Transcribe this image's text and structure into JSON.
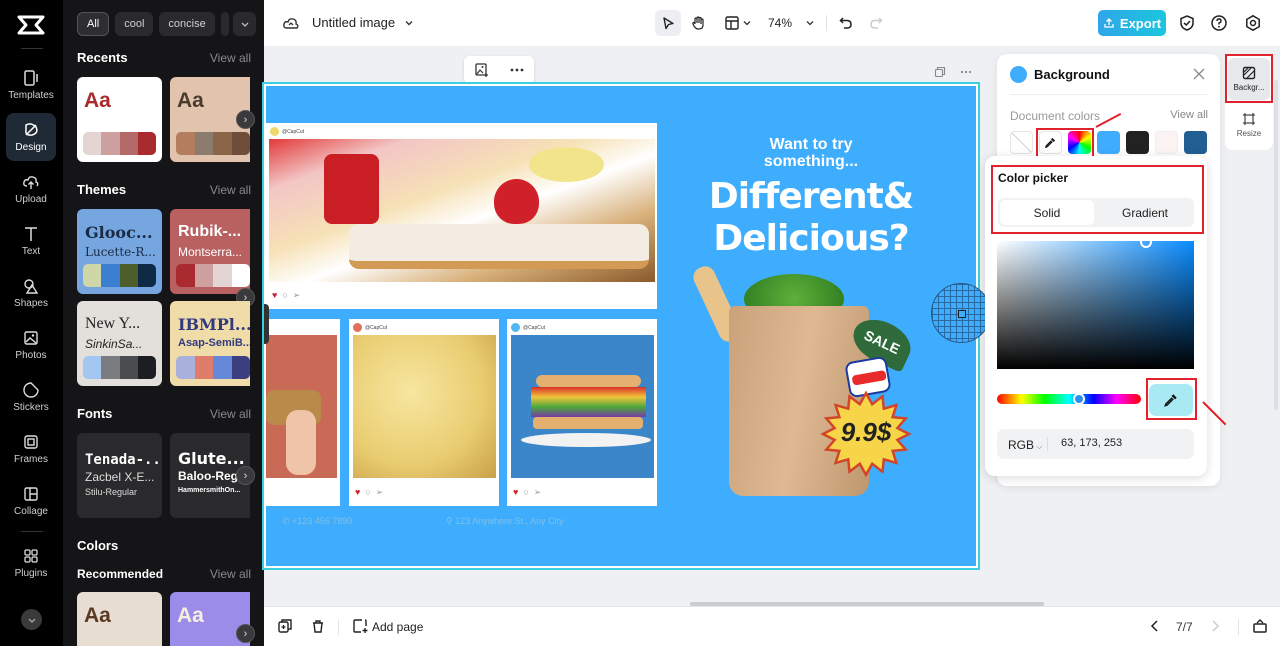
{
  "rail": {
    "items": [
      {
        "label": "Templates",
        "icon": "templates-icon"
      },
      {
        "label": "Design",
        "icon": "design-icon",
        "active": true
      },
      {
        "label": "Upload",
        "icon": "upload-icon"
      },
      {
        "label": "Text",
        "icon": "text-icon"
      },
      {
        "label": "Shapes",
        "icon": "shapes-icon"
      },
      {
        "label": "Photos",
        "icon": "photos-icon"
      },
      {
        "label": "Stickers",
        "icon": "stickers-icon"
      },
      {
        "label": "Frames",
        "icon": "frames-icon"
      },
      {
        "label": "Collage",
        "icon": "collage-icon"
      },
      {
        "label": "Plugins",
        "icon": "plugins-icon"
      }
    ]
  },
  "panel": {
    "chips": [
      "All",
      "cool",
      "concise"
    ],
    "recents": {
      "title": "Recents",
      "view_all": "View all",
      "cards": [
        {
          "aa": "Aa",
          "bg": "#ffffff",
          "fg": "#a92b2f",
          "palette": [
            "#e4d5d5",
            "#cfa0a0",
            "#b56a6a",
            "#a92b2f"
          ]
        },
        {
          "aa": "Aa",
          "bg": "#e2c3ad",
          "fg": "#4a3b2e",
          "palette": [
            "#b37d5e",
            "#8c7c6e",
            "#8c6448",
            "#6e4e39"
          ]
        }
      ]
    },
    "themes": {
      "title": "Themes",
      "view_all": "View all",
      "cards": [
        {
          "t1": "Glooc...",
          "t2": "Lucette-R...",
          "bg": "#76a6e0",
          "fg": "#1a2a44",
          "palette": [
            "#cfd6a8",
            "#3b7fd0",
            "#4e5e2a",
            "#0e2a45"
          ]
        },
        {
          "t1": "Rubik-...",
          "t2": "Montserra...",
          "bg": "#b96161",
          "fg": "#ffffff",
          "palette": [
            "#a92b2f",
            "#cfa0a0",
            "#e4d5d5",
            "#ffffff"
          ]
        },
        {
          "t1": "New Y...",
          "t2": "SinkinSa...",
          "bg": "#e3dfda",
          "fg": "#222222",
          "palette": [
            "#a3c7f0",
            "#7a7c80",
            "#4a4c50",
            "#1c1e22"
          ]
        },
        {
          "t1": "IBMPl...",
          "t2": "Asap-SemiB...",
          "bg": "#f0dca8",
          "fg": "#303a80",
          "palette": [
            "#aab0dc",
            "#e07c6a",
            "#6688d8",
            "#3b3f80"
          ]
        }
      ]
    },
    "fonts": {
      "title": "Fonts",
      "view_all": "View all",
      "cards": [
        {
          "t1": "Tenada-...",
          "t2": "Zacbel X-E...",
          "t3": "Stilu-Regular"
        },
        {
          "t1": "Glute...",
          "t2": "Baloo-Reg...",
          "t3": "HammersmithOn..."
        }
      ]
    },
    "colors": {
      "title": "Colors",
      "sub": "Recommended",
      "view_all": "View all",
      "cards": [
        {
          "aa": "Aa",
          "bg": "#e8ddd2",
          "fg": "#5a3a22"
        },
        {
          "aa": "Aa",
          "bg": "#9a8ce8",
          "fg": "#f5efe0"
        }
      ]
    }
  },
  "topbar": {
    "doc_title": "Untitled image",
    "zoom": "74%",
    "export_label": "Export"
  },
  "canvas": {
    "handle": "@CapCut",
    "headline_small": "Want to try something...",
    "headline_big": "Different& Delicious?",
    "price": "9.9$",
    "sale": "SALE",
    "phone": "+123 456 7890",
    "address": "123 Anywhere St., Any City",
    "bg_color": "#3fadfd"
  },
  "background_panel": {
    "title": "Background",
    "doc_colors_label": "Document colors",
    "view_all": "View all",
    "swatches": [
      "transparent",
      "eyedropper",
      "rainbow",
      "#3fadfd",
      "#222222",
      "#fbf4f2",
      "#215e91"
    ]
  },
  "color_picker": {
    "title": "Color picker",
    "tabs": [
      "Solid",
      "Gradient"
    ],
    "active_tab": "Solid",
    "mode": "RGB",
    "value": "63, 173, 253"
  },
  "side_tabs": [
    {
      "label": "Backgr...",
      "active": true
    },
    {
      "label": "Resize"
    }
  ],
  "bottombar": {
    "add_page": "Add page",
    "page_indicator": "7/7"
  }
}
